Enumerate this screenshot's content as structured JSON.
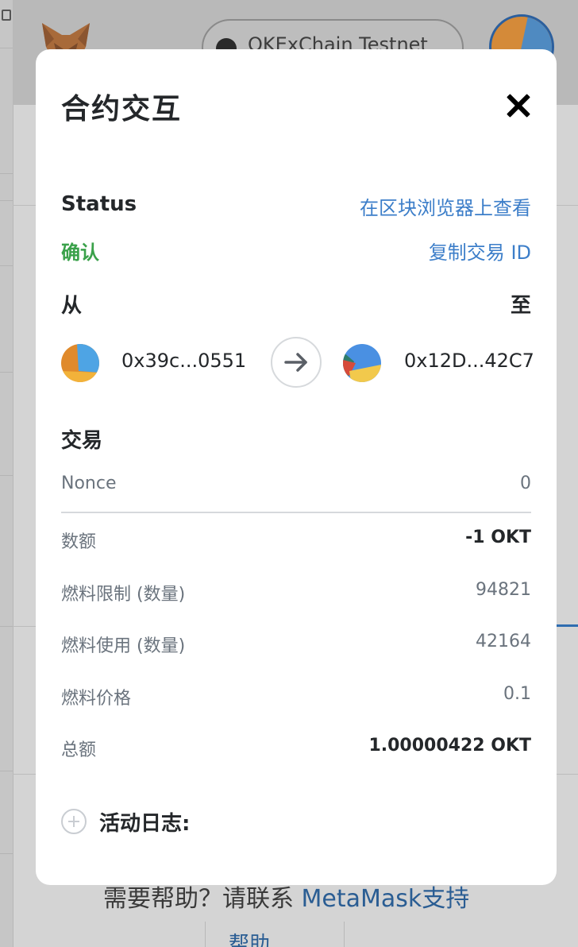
{
  "background": {
    "network_name": "OKExChain Testnet",
    "help_text": "需要帮助？请联系 ",
    "help_link": "MetaMask支持",
    "footer_text": "帮助"
  },
  "modal": {
    "title": "合约交互",
    "status_label": "Status",
    "view_on_explorer": "在区块浏览器上查看",
    "status_value": "确认",
    "copy_tx_id": "复制交易 ID",
    "from_label": "从",
    "to_label": "至",
    "from_address": "0x39c...0551",
    "to_address": "0x12D...42C7",
    "transaction_section": "交易",
    "rows": [
      {
        "label": "Nonce",
        "value": "0",
        "bold": false
      },
      {
        "label": "数额",
        "value": "-1 OKT",
        "bold": true
      },
      {
        "label": "燃料限制 (数量)",
        "value": "94821",
        "bold": false
      },
      {
        "label": "燃料使用 (数量)",
        "value": "42164",
        "bold": false
      },
      {
        "label": "燃料价格",
        "value": "0.1",
        "bold": false
      },
      {
        "label": "总额",
        "value": "1.00000422 OKT",
        "bold": true
      }
    ],
    "activity_log_label": "活动日志:"
  },
  "colors": {
    "link": "#3c7ec9",
    "status_confirmed": "#3aa14a",
    "text_primary": "#24272a",
    "text_secondary": "#6a737d"
  },
  "icons": {
    "close": "close-icon",
    "arrow": "arrow-right-icon",
    "expand": "plus-circle-icon"
  }
}
